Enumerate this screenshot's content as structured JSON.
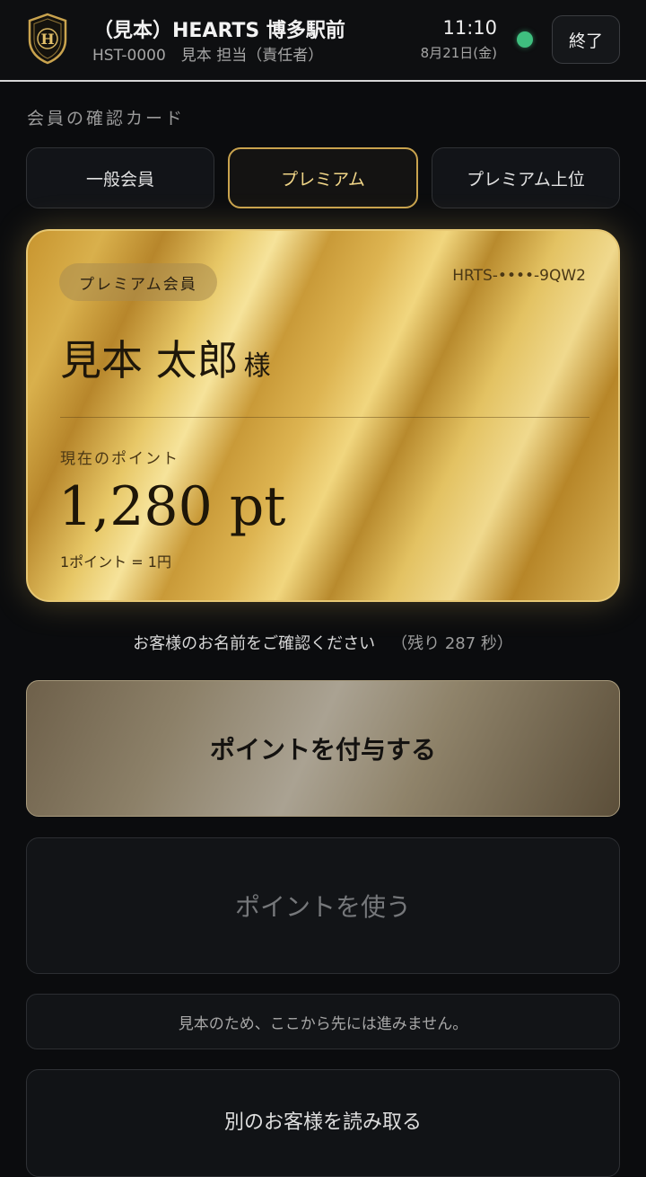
{
  "header": {
    "store_name": "（見本）HEARTS 博多駅前",
    "staff_info": "HST-0000　見本 担当（責任者）",
    "time": "11:10",
    "date": "8月21日(金)",
    "end_label": "終了",
    "logo_icon": "shield-h-logo-icon",
    "status_color": "#3fbf7f"
  },
  "section": {
    "label": "会員の確認カード"
  },
  "tabs": [
    {
      "label": "一般会員",
      "active": false
    },
    {
      "label": "プレミアム",
      "active": true
    },
    {
      "label": "プレミアム上位",
      "active": false
    }
  ],
  "card": {
    "badge": "プレミアム会員",
    "id": "HRTS-••••-9QW2",
    "name": "見本 太郎",
    "honorific": "様",
    "points_label": "現在のポイント",
    "points": "1,280 pt",
    "rate": "1ポイント = 1円"
  },
  "confirm": {
    "message": "お客様のお名前をご確認ください",
    "remaining": "（残り 287 秒）"
  },
  "actions": {
    "grant_label": "ポイントを付与する",
    "use_label": "ポイントを使う",
    "notice": "見本のため、ここから先には進みません。",
    "next_customer_label": "別のお客様を読み取る"
  },
  "colors": {
    "accent_gold": "#c9a34e",
    "background": "#0b0c0e"
  }
}
